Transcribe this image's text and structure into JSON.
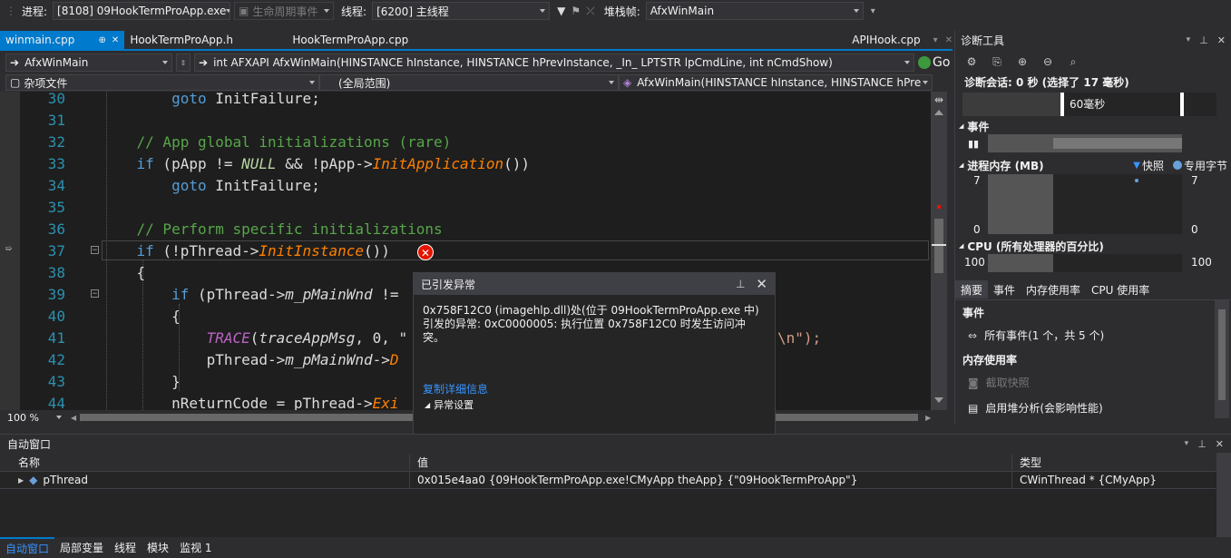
{
  "toolbar": {
    "process_label": "进程:",
    "process_value": "[8108] 09HookTermProApp.exe",
    "lifecycle_label": "生命周期事件",
    "thread_label": "线程:",
    "thread_value": "[6200] 主线程",
    "stack_label": "堆栈帧:",
    "stack_value": "AfxWinMain"
  },
  "tabs": [
    {
      "label": "winmain.cpp",
      "pin": "⊕",
      "close": "✕"
    },
    {
      "label": "HookTermProApp.h"
    },
    {
      "label": "HookTermProApp.cpp"
    },
    {
      "label": "APIHook.cpp"
    }
  ],
  "nav": {
    "scope_func": "AfxWinMain",
    "signature": "int AFXAPI AfxWinMain(HINSTANCE hInstance, HINSTANCE hPrevInstance, _In_ LPTSTR lpCmdLine, int nCmdShow)",
    "go_label": "Go",
    "misc_files": "杂项文件",
    "global_scope": "(全局范围)",
    "member": "AfxWinMain(HINSTANCE hInstance, HINSTANCE hPre"
  },
  "code_lines": [
    {
      "n": "30",
      "t": "        goto InitFailure;"
    },
    {
      "n": "31",
      "t": ""
    },
    {
      "n": "32",
      "t": "    // App global initializations (rare)"
    },
    {
      "n": "33",
      "t": "    if (pApp != NULL && !pApp->InitApplication())"
    },
    {
      "n": "34",
      "t": "        goto InitFailure;"
    },
    {
      "n": "35",
      "t": ""
    },
    {
      "n": "36",
      "t": "    // Perform specific initializations"
    },
    {
      "n": "37",
      "t": "    if (!pThread->InitInstance())"
    },
    {
      "n": "38",
      "t": "    {"
    },
    {
      "n": "39",
      "t": "        if (pThread->m_pMainWnd !="
    },
    {
      "n": "40",
      "t": "        {"
    },
    {
      "n": "41",
      "t": "            TRACE(traceAppMsg, 0, \""
    },
    {
      "n": "42",
      "t": "            pThread->m_pMainWnd->D"
    },
    {
      "n": "43",
      "t": "        }"
    },
    {
      "n": "44",
      "t": "        nReturnCode = pThread->Exi"
    }
  ],
  "code_tail_41": "\\n\");",
  "zoom": "100 %",
  "exception": {
    "title": "已引发异常",
    "message": "0x758F12C0 (imagehlp.dll)处(位于 09HookTermProApp.exe 中)引发的异常: 0xC0000005: 执行位置 0x758F12C0 时发生访问冲突。",
    "copy_link": "复制详细信息",
    "settings": "异常设置"
  },
  "diag": {
    "title": "诊断工具",
    "session": "诊断会话: 0 秒 (选择了 17 毫秒)",
    "timeline_label": "60毫秒",
    "events_header": "事件",
    "memory_header": "进程内存 (MB)",
    "snapshot_legend": "快照",
    "private_legend": "专用字节",
    "mem_max_left": "7",
    "mem_min_left": "0",
    "mem_max_right": "7",
    "mem_min_right": "0",
    "cpu_header": "CPU (所有处理器的百分比)",
    "cpu_left": "100",
    "cpu_right": "100",
    "tabs": [
      "摘要",
      "事件",
      "内存使用率",
      "CPU 使用率"
    ],
    "sum_events": "事件",
    "all_events": "所有事件(1 个，共 5 个)",
    "mem_usage": "内存使用率",
    "take_snapshot": "截取快照",
    "heap_profile": "启用堆分析(会影响性能)"
  },
  "autos": {
    "title": "自动窗口",
    "col_name": "名称",
    "col_value": "值",
    "col_type": "类型",
    "row_name": "pThread",
    "row_value": "0x015e4aa0 {09HookTermProApp.exe!CMyApp theApp} {\"09HookTermProApp\"}",
    "row_type": "CWinThread * {CMyApp}"
  },
  "bottom_tabs": [
    "自动窗口",
    "局部变量",
    "线程",
    "模块",
    "监视 1"
  ],
  "colors": {
    "accent": "#007acc",
    "error": "#e51400",
    "keyword": "#569cd6",
    "comment": "#57a64a",
    "line_number": "#2b91af"
  }
}
